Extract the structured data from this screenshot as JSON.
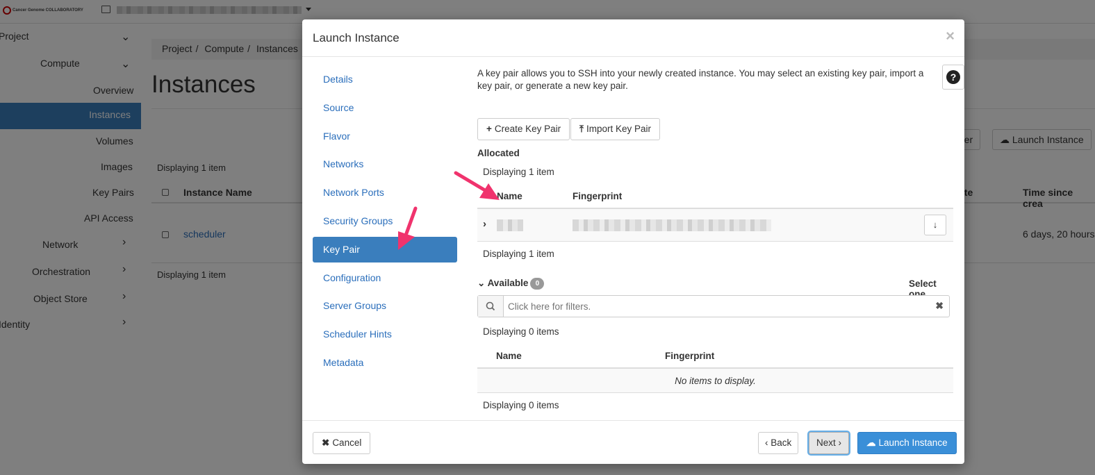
{
  "topbar": {
    "logo_text": "Cancer Genome COLLABORATORY"
  },
  "sidebar": {
    "items": [
      {
        "label": "Project"
      },
      {
        "label": "Compute"
      },
      {
        "label": "Overview"
      },
      {
        "label": "Instances"
      },
      {
        "label": "Volumes"
      },
      {
        "label": "Images"
      },
      {
        "label": "Key Pairs"
      },
      {
        "label": "API Access"
      },
      {
        "label": "Network"
      },
      {
        "label": "Orchestration"
      },
      {
        "label": "Object Store"
      },
      {
        "label": "Identity"
      }
    ]
  },
  "background": {
    "breadcrumb": [
      "Project",
      "Compute",
      "Instances"
    ],
    "page_title": "Instances",
    "filter_btn": "Filter",
    "launch_btn": "Launch Instance",
    "displaying": "Displaying 1 item",
    "col_name": "Instance Name",
    "col_state": "ate",
    "col_time": "Time since crea",
    "row_name": "scheduler",
    "row_time": "6 days, 20 hours"
  },
  "modal": {
    "title": "Launch Instance",
    "close": "×",
    "nav": [
      {
        "label": "Details"
      },
      {
        "label": "Source"
      },
      {
        "label": "Flavor"
      },
      {
        "label": "Networks"
      },
      {
        "label": "Network Ports"
      },
      {
        "label": "Security Groups"
      },
      {
        "label": "Key Pair"
      },
      {
        "label": "Configuration"
      },
      {
        "label": "Server Groups"
      },
      {
        "label": "Scheduler Hints"
      },
      {
        "label": "Metadata"
      }
    ],
    "active_nav": "Key Pair",
    "intro": "A key pair allows you to SSH into your newly created instance. You may select an existing key pair, import a key pair, or generate a new key pair.",
    "create_btn": "Create Key Pair",
    "import_btn": "Import Key Pair",
    "allocated": {
      "label": "Allocated",
      "displaying_top": "Displaying 1 item",
      "col_name": "Name",
      "col_fingerprint": "Fingerprint",
      "displaying_bottom": "Displaying 1 item"
    },
    "available": {
      "label": "Available",
      "count": "0",
      "select_one": "Select one",
      "filter_placeholder": "Click here for filters.",
      "displaying_top": "Displaying 0 items",
      "col_name": "Name",
      "col_fingerprint": "Fingerprint",
      "empty": "No items to display.",
      "displaying_bottom": "Displaying 0 items"
    },
    "footer": {
      "cancel": "Cancel",
      "back": "Back",
      "next": "Next",
      "launch": "Launch Instance"
    }
  },
  "colors": {
    "accent": "#3a7ebd",
    "link": "#2a6ebb",
    "primary_button": "#3a8fd8",
    "annotation_arrow": "#f0336d"
  }
}
